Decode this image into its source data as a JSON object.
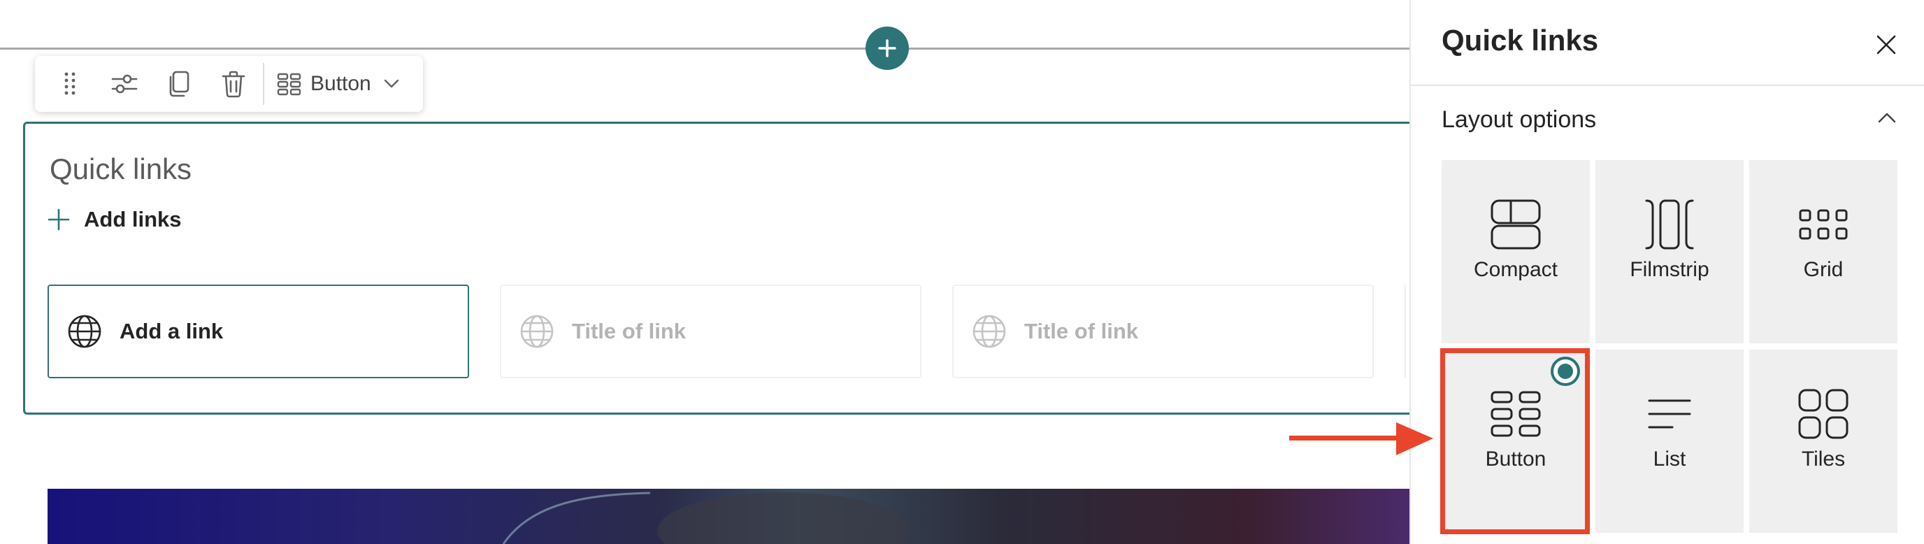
{
  "toolbar": {
    "items": [
      {
        "name": "drag-handle",
        "icon": "drag-dots-icon"
      },
      {
        "name": "edit-properties",
        "icon": "sliders-icon"
      },
      {
        "name": "duplicate",
        "icon": "copy-icon"
      },
      {
        "name": "delete",
        "icon": "trash-icon"
      }
    ],
    "layout_label": "Button"
  },
  "webpart": {
    "title": "Quick links",
    "add_links_label": "Add links",
    "links": [
      {
        "label": "Add a link",
        "state": "active"
      },
      {
        "label": "Title of link",
        "state": "placeholder"
      },
      {
        "label": "Title of link",
        "state": "placeholder"
      }
    ]
  },
  "pane": {
    "title": "Quick links",
    "section_label": "Layout options",
    "layouts": [
      {
        "label": "Compact",
        "icon": "compact-layout-icon",
        "selected": false
      },
      {
        "label": "Filmstrip",
        "icon": "filmstrip-layout-icon",
        "selected": false
      },
      {
        "label": "Grid",
        "icon": "grid-layout-icon",
        "selected": false
      },
      {
        "label": "Button",
        "icon": "button-layout-icon",
        "selected": true
      },
      {
        "label": "List",
        "icon": "list-layout-icon",
        "selected": false
      },
      {
        "label": "Tiles",
        "icon": "tiles-layout-icon",
        "selected": false
      }
    ]
  },
  "colors": {
    "accent": "#2c7478",
    "callout": "#e8452c",
    "tile_bg": "#efefef"
  }
}
